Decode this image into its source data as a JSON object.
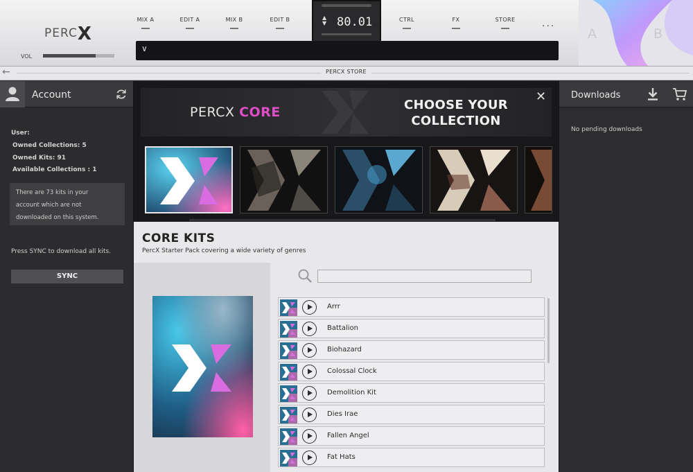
{
  "app": {
    "logo_text": "PERC",
    "logo_x": "X",
    "vol_label": "VOL",
    "vol_level": 0.74
  },
  "tabs": [
    "MIX A",
    "EDIT A",
    "MIX B",
    "EDIT B",
    "CTRL",
    "FX",
    "STORE"
  ],
  "tempo": {
    "value": "80.01",
    "arrows": "▲▼"
  },
  "more_menu": "...",
  "preset_chevron": "∨",
  "ab": {
    "a": "A",
    "b": "B"
  },
  "nav": {
    "back": "←",
    "title": "PERCX STORE"
  },
  "account": {
    "title": "Account",
    "user_label": "User:",
    "owned_collections": "Owned Collections: 5",
    "owned_kits": "Owned Kits:  91",
    "available_collections": "Available Collections : 1",
    "notice_line1": "There are 73 kits in your",
    "notice_line2": "account which are not",
    "notice_line3": "downloaded on this system.",
    "sync_hint": "Press SYNC to download all kits.",
    "sync_label": "SYNC"
  },
  "downloads": {
    "title": "Downloads",
    "pending": "No pending downloads"
  },
  "hero": {
    "logo_prefix": "PERCX",
    "logo_highlight": "CORE",
    "cta_line1": "CHOOSE YOUR",
    "cta_line2": "COLLECTION",
    "close": "✕"
  },
  "kits": {
    "title": "CORE KITS",
    "subtitle": "PercX Starter Pack covering a wide variety of genres",
    "search_placeholder": "",
    "items": [
      "Arrr",
      "Battalion",
      "Biohazard",
      "Colossal Clock",
      "Demolition Kit",
      "Dies Irae",
      "Fallen Angel",
      "Fat Hats"
    ]
  },
  "colors": {
    "accent_pink": "#e04ec7",
    "accent_cyan": "#34b8e0"
  }
}
